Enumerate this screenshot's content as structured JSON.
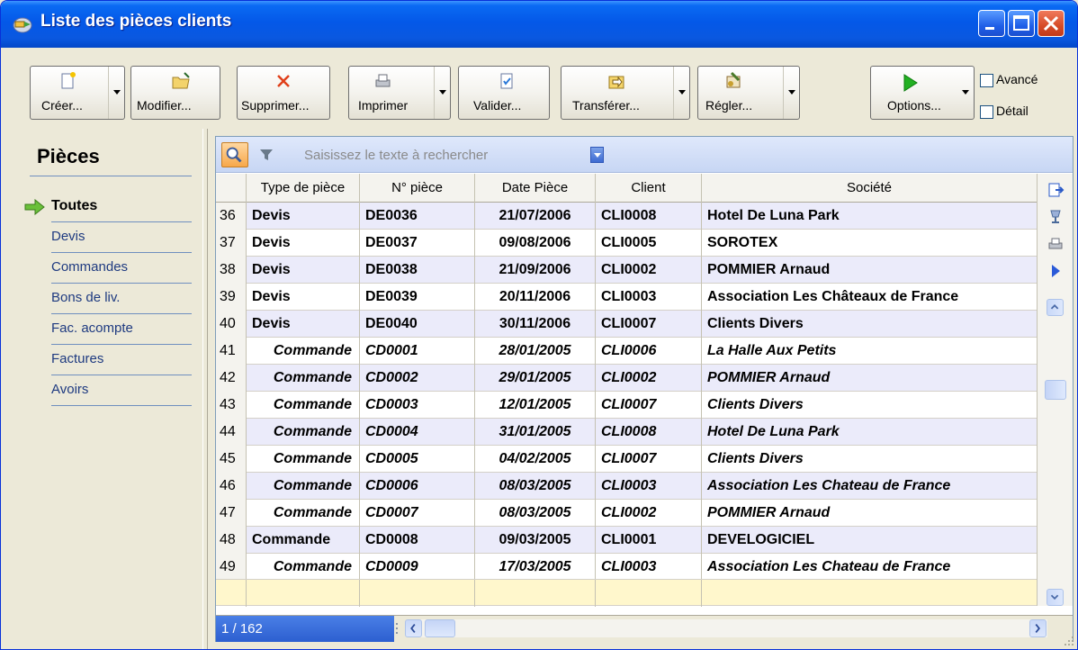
{
  "window": {
    "title": "Liste des pièces clients",
    "accent_color": "#0458e8",
    "close_color": "#d64b27"
  },
  "toolbar": {
    "buttons": [
      {
        "label": "Créer...",
        "icon": "new-document-icon",
        "has_dropdown": true
      },
      {
        "label": "Modifier...",
        "icon": "open-folder-icon",
        "has_dropdown": false
      },
      {
        "label": "Supprimer...",
        "icon": "delete-x-icon",
        "has_dropdown": false
      },
      {
        "label": "Imprimer",
        "icon": "printer-icon",
        "has_dropdown": true
      },
      {
        "label": "Valider...",
        "icon": "validate-document-icon",
        "has_dropdown": false
      },
      {
        "label": "Transférer...",
        "icon": "transfer-box-icon",
        "has_dropdown": true
      },
      {
        "label": "Régler...",
        "icon": "payment-icon",
        "has_dropdown": true
      },
      {
        "label": "Options...",
        "icon": "play-icon",
        "has_dropdown": true
      }
    ],
    "checkboxes": [
      {
        "label": "Avancé",
        "checked": false
      },
      {
        "label": "Détail",
        "checked": false
      }
    ]
  },
  "sidebar": {
    "title": "Pièces",
    "items": [
      {
        "label": "Toutes",
        "active": true
      },
      {
        "label": "Devis",
        "active": false
      },
      {
        "label": "Commandes",
        "active": false
      },
      {
        "label": "Bons de liv.",
        "active": false
      },
      {
        "label": "Fac. acompte",
        "active": false
      },
      {
        "label": "Factures",
        "active": false
      },
      {
        "label": "Avoirs",
        "active": false
      }
    ]
  },
  "search": {
    "placeholder": "Saisissez le texte à rechercher"
  },
  "grid": {
    "columns": [
      "",
      "Type de pièce",
      "N° pièce",
      "Date Pièce",
      "Client",
      "Société"
    ],
    "rows": [
      {
        "num": "36",
        "type": "Devis",
        "numero": "DE0036",
        "date": "21/07/2006",
        "client": "CLI0008",
        "societe": "Hotel De Luna Park",
        "style": "b"
      },
      {
        "num": "37",
        "type": "Devis",
        "numero": "DE0037",
        "date": "09/08/2006",
        "client": "CLI0005",
        "societe": "SOROTEX",
        "style": "b"
      },
      {
        "num": "38",
        "type": "Devis",
        "numero": "DE0038",
        "date": "21/09/2006",
        "client": "CLI0002",
        "societe": "POMMIER Arnaud",
        "style": "b"
      },
      {
        "num": "39",
        "type": "Devis",
        "numero": "DE0039",
        "date": "20/11/2006",
        "client": "CLI0003",
        "societe": "Association Les Châteaux de France",
        "style": "b"
      },
      {
        "num": "40",
        "type": "Devis",
        "numero": "DE0040",
        "date": "30/11/2006",
        "client": "CLI0007",
        "societe": "Clients Divers",
        "style": "b"
      },
      {
        "num": "41",
        "type": "Commande",
        "numero": "CD0001",
        "date": "28/01/2005",
        "client": "CLI0006",
        "societe": "La Halle Aux Petits",
        "style": "bi"
      },
      {
        "num": "42",
        "type": "Commande",
        "numero": "CD0002",
        "date": "29/01/2005",
        "client": "CLI0002",
        "societe": "POMMIER Arnaud",
        "style": "bi"
      },
      {
        "num": "43",
        "type": "Commande",
        "numero": "CD0003",
        "date": "12/01/2005",
        "client": "CLI0007",
        "societe": "Clients Divers",
        "style": "bi"
      },
      {
        "num": "44",
        "type": "Commande",
        "numero": "CD0004",
        "date": "31/01/2005",
        "client": "CLI0008",
        "societe": "Hotel De Luna Park",
        "style": "bi"
      },
      {
        "num": "45",
        "type": "Commande",
        "numero": "CD0005",
        "date": "04/02/2005",
        "client": "CLI0007",
        "societe": "Clients Divers",
        "style": "bi"
      },
      {
        "num": "46",
        "type": "Commande",
        "numero": "CD0006",
        "date": "08/03/2005",
        "client": "CLI0003",
        "societe": "Association Les Chateau de France",
        "style": "bi"
      },
      {
        "num": "47",
        "type": "Commande",
        "numero": "CD0007",
        "date": "08/03/2005",
        "client": "CLI0002",
        "societe": "POMMIER Arnaud",
        "style": "bi"
      },
      {
        "num": "48",
        "type": "Commande",
        "numero": "CD0008",
        "date": "09/03/2005",
        "client": "CLI0001",
        "societe": "DEVELOGICIEL",
        "style": "b"
      },
      {
        "num": "49",
        "type": "Commande",
        "numero": "CD0009",
        "date": "17/03/2005",
        "client": "CLI0003",
        "societe": "Association Les Chateau de France",
        "style": "bi"
      }
    ],
    "side_icons": [
      "export-icon",
      "chalice-icon",
      "print-small-icon",
      "play-small-icon"
    ]
  },
  "footer": {
    "pager": "1 / 162"
  }
}
